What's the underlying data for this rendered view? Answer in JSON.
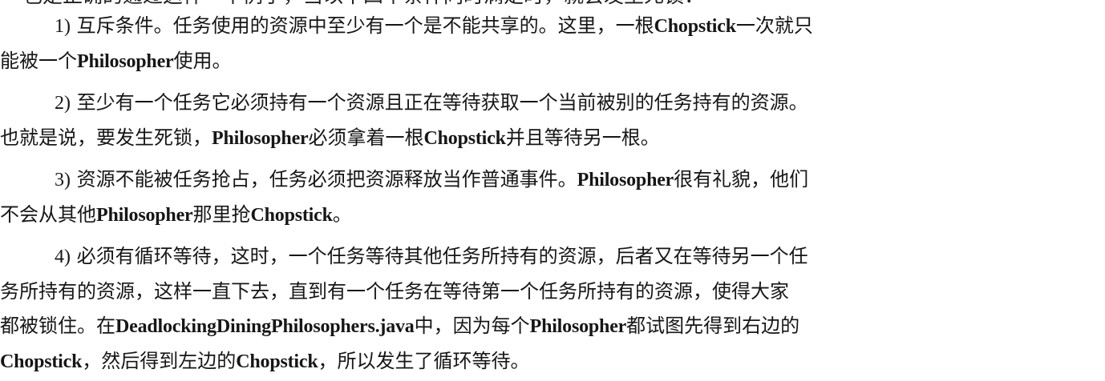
{
  "top_cut_line": "也是正确的通过这样一个例子，当以下四个条件同时满足时，就会发生死锁：",
  "items": [
    {
      "number": "1)",
      "lines": [
        [
          "互斥条件。任务使用的资源中至少有一个是不能共享的。这里，一根",
          "Chopstick",
          "一次就只"
        ],
        [
          "能被一个",
          "Philosopher",
          "使用。"
        ]
      ]
    },
    {
      "number": "2)",
      "lines": [
        [
          "至少有一个任务它必须持有一个资源且正在等待获取一个当前被别的任务持有的资源。"
        ],
        [
          "也就是说，要发生死锁，",
          "Philosopher",
          "必须拿着一根",
          "Chopstick",
          "并且等待另一根。"
        ]
      ]
    },
    {
      "number": "3)",
      "lines": [
        [
          "资源不能被任务抢占，任务必须把资源释放当作普通事件。",
          "Philosopher",
          "很有礼貌，他们"
        ],
        [
          "不会从其他",
          "Philosopher",
          "那里抢",
          "Chopstick",
          "。"
        ]
      ]
    },
    {
      "number": "4)",
      "lines": [
        [
          "必须有循环等待，这时，一个任务等待其他任务所持有的资源，后者又在等待另一个任"
        ],
        [
          "务所持有的资源，这样一直下去，直到有一个任务在等待第一个任务所持有的资源，使得大家"
        ],
        [
          "都被锁住。在",
          "DeadlockingDiningPhilosophers.java",
          "中，因为每个",
          "Philosopher",
          "都试图先得到右边的"
        ],
        [
          "Chopstick",
          "，然后得到左边的",
          "Chopstick",
          "，所以发生了循环等待。"
        ]
      ]
    }
  ]
}
